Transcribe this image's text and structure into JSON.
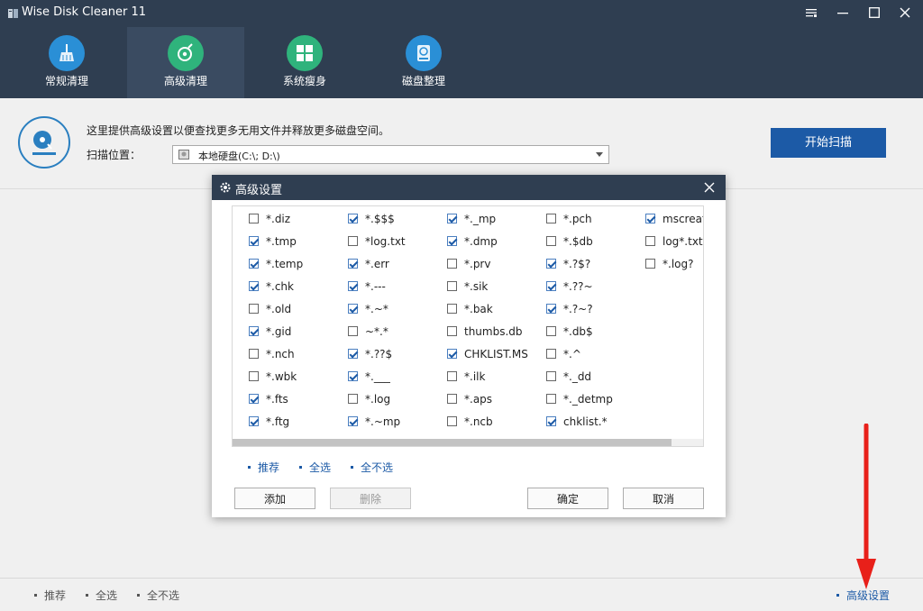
{
  "window": {
    "title": "Wise Disk Cleaner 11",
    "controls": [
      "menu-icon",
      "minimize-icon",
      "maximize-icon",
      "close-icon"
    ]
  },
  "nav": {
    "tabs": [
      {
        "label": "常规清理",
        "icon": "broom-icon",
        "color": "#2a8fd6",
        "active": false
      },
      {
        "label": "高级清理",
        "icon": "disk-search-icon",
        "color": "#2fb37c",
        "active": true
      },
      {
        "label": "系统瘦身",
        "icon": "windows-icon",
        "color": "#2fb37c",
        "active": false
      },
      {
        "label": "磁盘整理",
        "icon": "drive-icon",
        "color": "#2a8fd6",
        "active": false
      }
    ]
  },
  "main": {
    "description": "这里提供高级设置以便查找更多无用文件并释放更多磁盘空间。",
    "scan_location_label": "扫描位置：",
    "scan_location_value": "本地硬盘(C:\\; D:\\)",
    "scan_button": "开始扫描"
  },
  "bottom": {
    "links": [
      "推荐",
      "全选",
      "全不选"
    ],
    "advanced_link": "高级设置"
  },
  "dialog": {
    "title": "高级设置",
    "columns": [
      [
        {
          "name": "*.diz",
          "checked": false
        },
        {
          "name": "*.tmp",
          "checked": true
        },
        {
          "name": "*.temp",
          "checked": true
        },
        {
          "name": "*.chk",
          "checked": true
        },
        {
          "name": "*.old",
          "checked": false
        },
        {
          "name": "*.gid",
          "checked": true
        },
        {
          "name": "*.nch",
          "checked": false
        },
        {
          "name": "*.wbk",
          "checked": false
        },
        {
          "name": "*.fts",
          "checked": true
        },
        {
          "name": "*.ftg",
          "checked": true
        }
      ],
      [
        {
          "name": "*.$$$",
          "checked": true
        },
        {
          "name": "*log.txt",
          "checked": false
        },
        {
          "name": "*.err",
          "checked": true
        },
        {
          "name": "*.---",
          "checked": true
        },
        {
          "name": "*.~*",
          "checked": true
        },
        {
          "name": "~*.*",
          "checked": false
        },
        {
          "name": "*.??$",
          "checked": true
        },
        {
          "name": "*.___",
          "checked": true
        },
        {
          "name": "*.log",
          "checked": false
        },
        {
          "name": "*.~mp",
          "checked": true
        }
      ],
      [
        {
          "name": "*._mp",
          "checked": true
        },
        {
          "name": "*.dmp",
          "checked": true
        },
        {
          "name": "*.prv",
          "checked": false
        },
        {
          "name": "*.sik",
          "checked": false
        },
        {
          "name": "*.bak",
          "checked": false
        },
        {
          "name": "thumbs.db",
          "checked": false
        },
        {
          "name": "CHKLIST.MS",
          "checked": true
        },
        {
          "name": "*.ilk",
          "checked": false
        },
        {
          "name": "*.aps",
          "checked": false
        },
        {
          "name": "*.ncb",
          "checked": false
        }
      ],
      [
        {
          "name": "*.pch",
          "checked": false
        },
        {
          "name": "*.$db",
          "checked": false
        },
        {
          "name": "*.?$?",
          "checked": true
        },
        {
          "name": "*.??~",
          "checked": true
        },
        {
          "name": "*.?~?",
          "checked": true
        },
        {
          "name": "*.db$",
          "checked": false
        },
        {
          "name": "*.^",
          "checked": false
        },
        {
          "name": "*._dd",
          "checked": false
        },
        {
          "name": "*._detmp",
          "checked": false
        },
        {
          "name": "chklist.*",
          "checked": true
        }
      ],
      [
        {
          "name": "mscreat",
          "checked": true
        },
        {
          "name": "log*.txt",
          "checked": false
        },
        {
          "name": "*.log?",
          "checked": false
        }
      ]
    ],
    "links": [
      "推荐",
      "全选",
      "全不选"
    ],
    "buttons": {
      "add": "添加",
      "delete": "删除",
      "ok": "确定",
      "cancel": "取消"
    }
  },
  "colors": {
    "header_bg": "#2f3e51",
    "accent_blue": "#1c5aa6",
    "annotation_arrow": "#e8201a"
  }
}
